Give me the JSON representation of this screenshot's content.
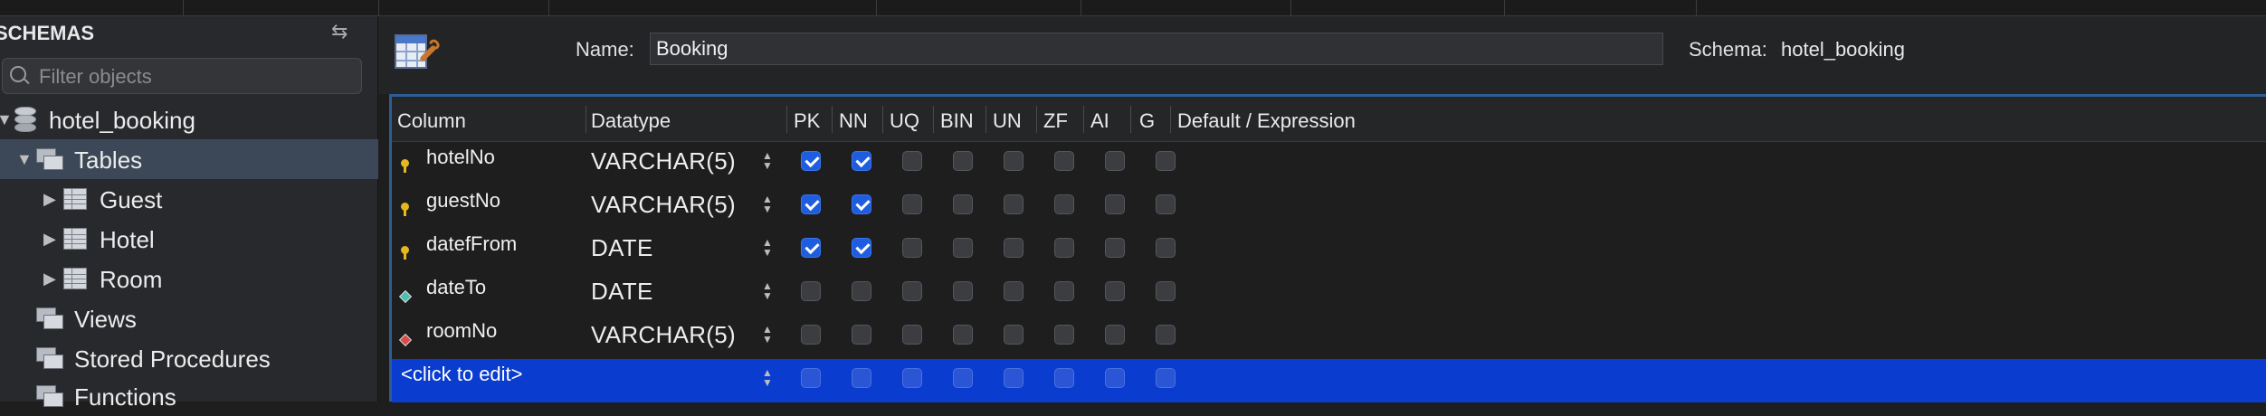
{
  "sidebar": {
    "title": "SCHEMAS",
    "filter_placeholder": "Filter objects",
    "tree": [
      {
        "label": "hotel_booking",
        "icon": "database-icon",
        "expanded": true
      },
      {
        "label": "Tables",
        "icon": "tables-icon",
        "expanded": true,
        "selected": true
      },
      {
        "label": "Guest",
        "icon": "table-icon"
      },
      {
        "label": "Hotel",
        "icon": "table-icon"
      },
      {
        "label": "Room",
        "icon": "table-icon"
      },
      {
        "label": "Views",
        "icon": "tables-icon"
      },
      {
        "label": "Stored Procedures",
        "icon": "tables-icon"
      },
      {
        "label": "Functions",
        "icon": "tables-icon"
      }
    ]
  },
  "editor": {
    "name_label": "Name:",
    "name_value": "Booking",
    "schema_label": "Schema:",
    "schema_value": "hotel_booking"
  },
  "grid": {
    "headers": [
      "Column",
      "Datatype",
      "PK",
      "NN",
      "UQ",
      "BIN",
      "UN",
      "ZF",
      "AI",
      "G",
      "Default / Expression"
    ],
    "flag_keys": [
      "PK",
      "NN",
      "UQ",
      "BIN",
      "UN",
      "ZF",
      "AI",
      "G"
    ],
    "rows": [
      {
        "name": "hotelNo",
        "type": "VARCHAR(5)",
        "icon": "primary-key-icon",
        "flags": [
          true,
          true,
          false,
          false,
          false,
          false,
          false,
          false
        ]
      },
      {
        "name": "guestNo",
        "type": "VARCHAR(5)",
        "icon": "primary-key-icon",
        "flags": [
          true,
          true,
          false,
          false,
          false,
          false,
          false,
          false
        ]
      },
      {
        "name": "datefFrom",
        "type": "DATE",
        "icon": "primary-key-icon",
        "flags": [
          true,
          true,
          false,
          false,
          false,
          false,
          false,
          false
        ]
      },
      {
        "name": "dateTo",
        "type": "DATE",
        "icon": "nullable-column-icon",
        "flags": [
          false,
          false,
          false,
          false,
          false,
          false,
          false,
          false
        ]
      },
      {
        "name": "roomNo",
        "type": "VARCHAR(5)",
        "icon": "foreign-key-column-icon",
        "flags": [
          false,
          false,
          false,
          false,
          false,
          false,
          false,
          false
        ]
      }
    ],
    "new_row_label": "<click to edit>"
  }
}
